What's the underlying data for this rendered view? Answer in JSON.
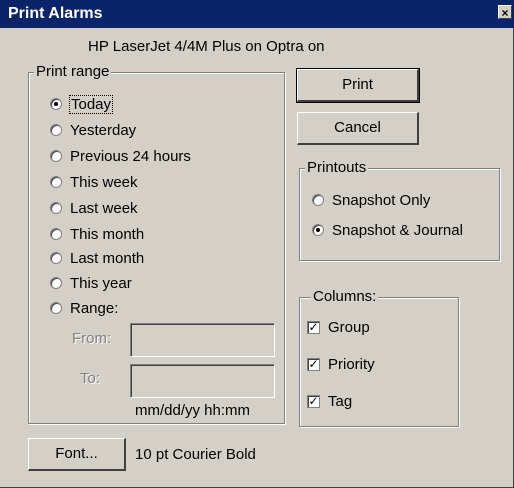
{
  "window": {
    "title": "Print Alarms",
    "close_glyph": "×"
  },
  "printer": "HP LaserJet 4/4M Plus on Optra on",
  "print_range": {
    "label": "Print range",
    "options": [
      {
        "label": "Today",
        "selected": true
      },
      {
        "label": "Yesterday",
        "selected": false
      },
      {
        "label": "Previous 24 hours",
        "selected": false
      },
      {
        "label": "This week",
        "selected": false
      },
      {
        "label": "Last week",
        "selected": false
      },
      {
        "label": "This month",
        "selected": false
      },
      {
        "label": "Last month",
        "selected": false
      },
      {
        "label": "This year",
        "selected": false
      },
      {
        "label": "Range:",
        "selected": false
      }
    ],
    "from_label": "From:",
    "from_value": "",
    "to_label": "To:",
    "to_value": "",
    "format_hint": "mm/dd/yy hh:mm"
  },
  "buttons": {
    "print": "Print",
    "cancel": "Cancel",
    "font": "Font..."
  },
  "printouts": {
    "label": "Printouts",
    "options": [
      {
        "label": "Snapshot Only",
        "selected": false
      },
      {
        "label": "Snapshot & Journal",
        "selected": true
      }
    ]
  },
  "columns": {
    "label": "Columns:",
    "items": [
      {
        "label": "Group",
        "checked": true
      },
      {
        "label": "Priority",
        "checked": true
      },
      {
        "label": "Tag",
        "checked": true
      }
    ]
  },
  "font_description": "10 pt Courier Bold",
  "check_glyph": "✓"
}
